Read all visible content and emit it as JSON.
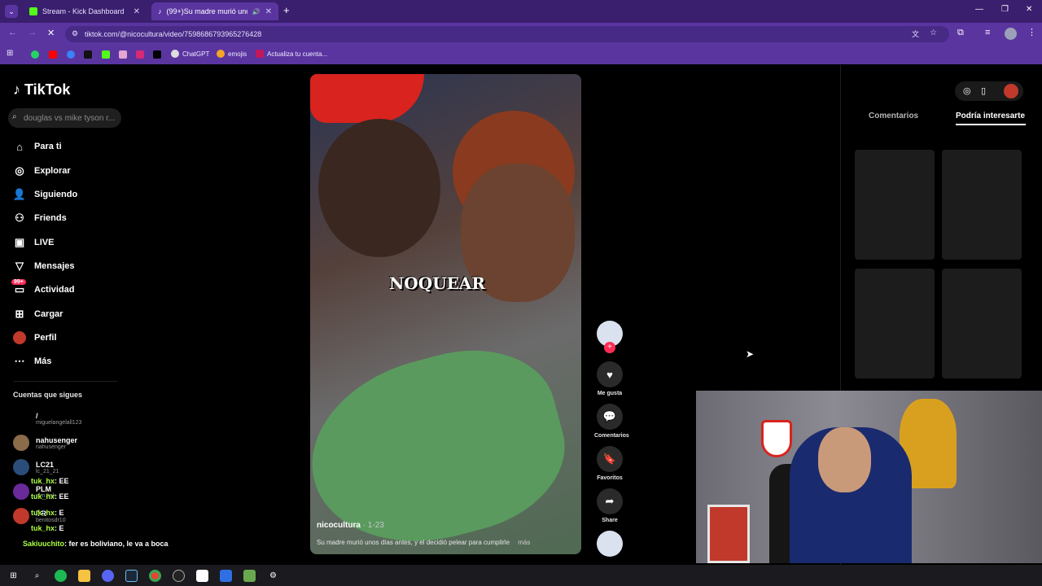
{
  "browser": {
    "tabs": [
      {
        "title": "Stream - Kick Dashboard",
        "active": false
      },
      {
        "title": "(99+)Su madre murió unos",
        "active": true
      }
    ],
    "new_tab": "+",
    "url": "tiktok.com/@nicocultura/video/7598686793965276428",
    "bookmarks": [
      "ChatGPT",
      "emojis",
      "Actualiza tu cuenta..."
    ]
  },
  "sidebar": {
    "logo": "TikTok",
    "search_placeholder": "douglas vs mike tyson r...",
    "nav": [
      {
        "label": "Para ti",
        "icon": "home-icon"
      },
      {
        "label": "Explorar",
        "icon": "compass-icon"
      },
      {
        "label": "Siguiendo",
        "icon": "following-icon"
      },
      {
        "label": "Friends",
        "icon": "friends-icon"
      },
      {
        "label": "LIVE",
        "icon": "live-icon"
      },
      {
        "label": "Mensajes",
        "icon": "messages-icon"
      },
      {
        "label": "Actividad",
        "icon": "activity-icon",
        "badge": "99+"
      },
      {
        "label": "Cargar",
        "icon": "upload-icon"
      },
      {
        "label": "Perfil",
        "icon": "profile-icon"
      },
      {
        "label": "Más",
        "icon": "more-icon"
      }
    ],
    "following_title": "Cuentas que sigues",
    "following": [
      {
        "name": "/",
        "user": "miguelangelall123"
      },
      {
        "name": "nahusenger",
        "user": "nahusenger"
      },
      {
        "name": "LC21",
        "user": "lc_21_21"
      },
      {
        "name": "PLM",
        "user": "plm..tok"
      },
      {
        "name": "DR",
        "user": "benitosdr10"
      }
    ]
  },
  "video": {
    "caption_overlay": "NOQUEAR",
    "author": "nicocultura",
    "date": "· 1-23",
    "description": "Su madre murió unos días antes, y el decidió pelear para cumplirle",
    "more": "más"
  },
  "actions": [
    {
      "label": "",
      "icon": "author-avatar-icon"
    },
    {
      "label": "Me gusta",
      "icon": "heart-icon"
    },
    {
      "label": "Comentarios",
      "icon": "comment-icon"
    },
    {
      "label": "Favoritos",
      "icon": "bookmark-icon"
    },
    {
      "label": "Share",
      "icon": "share-icon"
    }
  ],
  "right_panel": {
    "tab_comments": "Comentarios",
    "tab_recommended": "Podría interesarte"
  },
  "chat": [
    {
      "user": "tuk_hx",
      "msg": ": EE"
    },
    {
      "user": "tuk_hx",
      "msg": ": EE"
    },
    {
      "user": "tuk_hx",
      "msg": ": E"
    },
    {
      "user": "tuk_hx",
      "msg": ": E"
    },
    {
      "user": "Sakiuuchito",
      "msg": ": fer es boliviano, le va a boca"
    }
  ],
  "colors": {
    "tab_bar": "#3a1f6e",
    "toolbar": "#5a35a0",
    "accent": "#fe2c55",
    "chat": "#aaff44"
  }
}
